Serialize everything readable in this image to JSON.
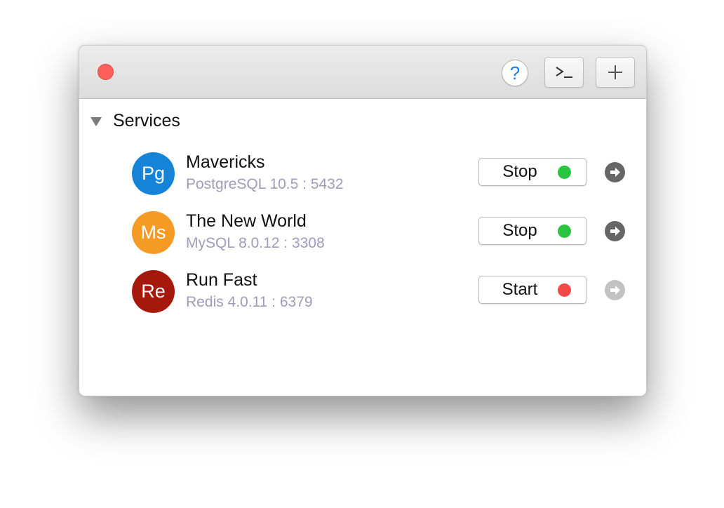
{
  "window": {
    "close_icon": "close-icon"
  },
  "toolbar": {
    "help_label": "?",
    "terminal_label": ">_",
    "add_label": "+"
  },
  "section": {
    "title": "Services",
    "expanded": true
  },
  "services": [
    {
      "avatar": "Pg",
      "avatar_color": "#1583d8",
      "name": "Mavericks",
      "detail": "PostgreSQL 10.5 : 5432",
      "button_label": "Stop",
      "status_color": "#2bc43e",
      "arrow_color": "#666666"
    },
    {
      "avatar": "Ms",
      "avatar_color": "#f59a23",
      "name": "The New World",
      "detail": "MySQL 8.0.12 : 3308",
      "button_label": "Stop",
      "status_color": "#2bc43e",
      "arrow_color": "#666666"
    },
    {
      "avatar": "Re",
      "avatar_color": "#a5190d",
      "name": "Run Fast",
      "detail": "Redis 4.0.11 : 6379",
      "button_label": "Start",
      "status_color": "#f24848",
      "arrow_color": "#c2c2c2"
    }
  ]
}
